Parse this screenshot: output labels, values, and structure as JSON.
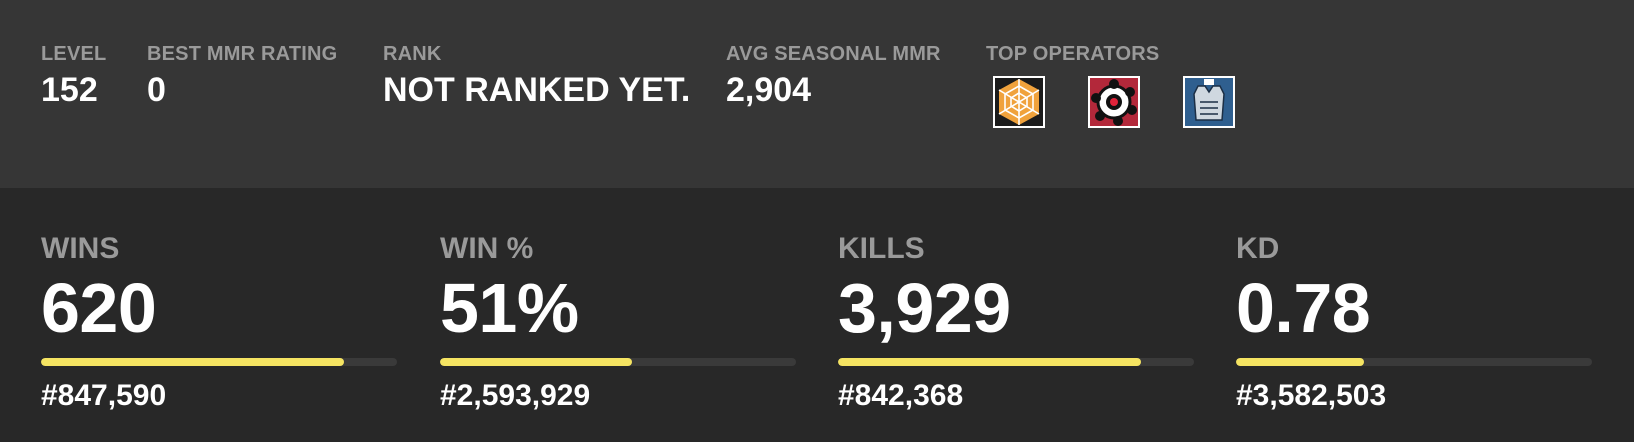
{
  "summary": {
    "level": {
      "label": "LEVEL",
      "value": "152"
    },
    "best_mmr": {
      "label": "BEST MMR RATING",
      "value": "0"
    },
    "rank": {
      "label": "RANK",
      "value": "NOT RANKED YET."
    },
    "avg_mmr": {
      "label": "AVG SEASONAL MMR",
      "value": "2,904"
    },
    "top_operators": {
      "label": "TOP OPERATORS",
      "icons": [
        "orange-web-operator-icon",
        "red-gear-operator-icon",
        "blue-vest-operator-icon"
      ]
    }
  },
  "stats": [
    {
      "label": "WINS",
      "value": "620",
      "rank": "#847,590",
      "progress": 0.85
    },
    {
      "label": "WIN %",
      "value": "51%",
      "rank": "#2,593,929",
      "progress": 0.54
    },
    {
      "label": "KILLS",
      "value": "3,929",
      "rank": "#842,368",
      "progress": 0.85
    },
    {
      "label": "KD",
      "value": "0.78",
      "rank": "#3,582,503",
      "progress": 0.36
    }
  ],
  "colors": {
    "top_background": "#363636",
    "bottom_background": "#282828",
    "label": "#9a9a9a",
    "value": "#ffffff",
    "bar_fill": "#f5e462",
    "bar_track": "#3a3a3a"
  }
}
